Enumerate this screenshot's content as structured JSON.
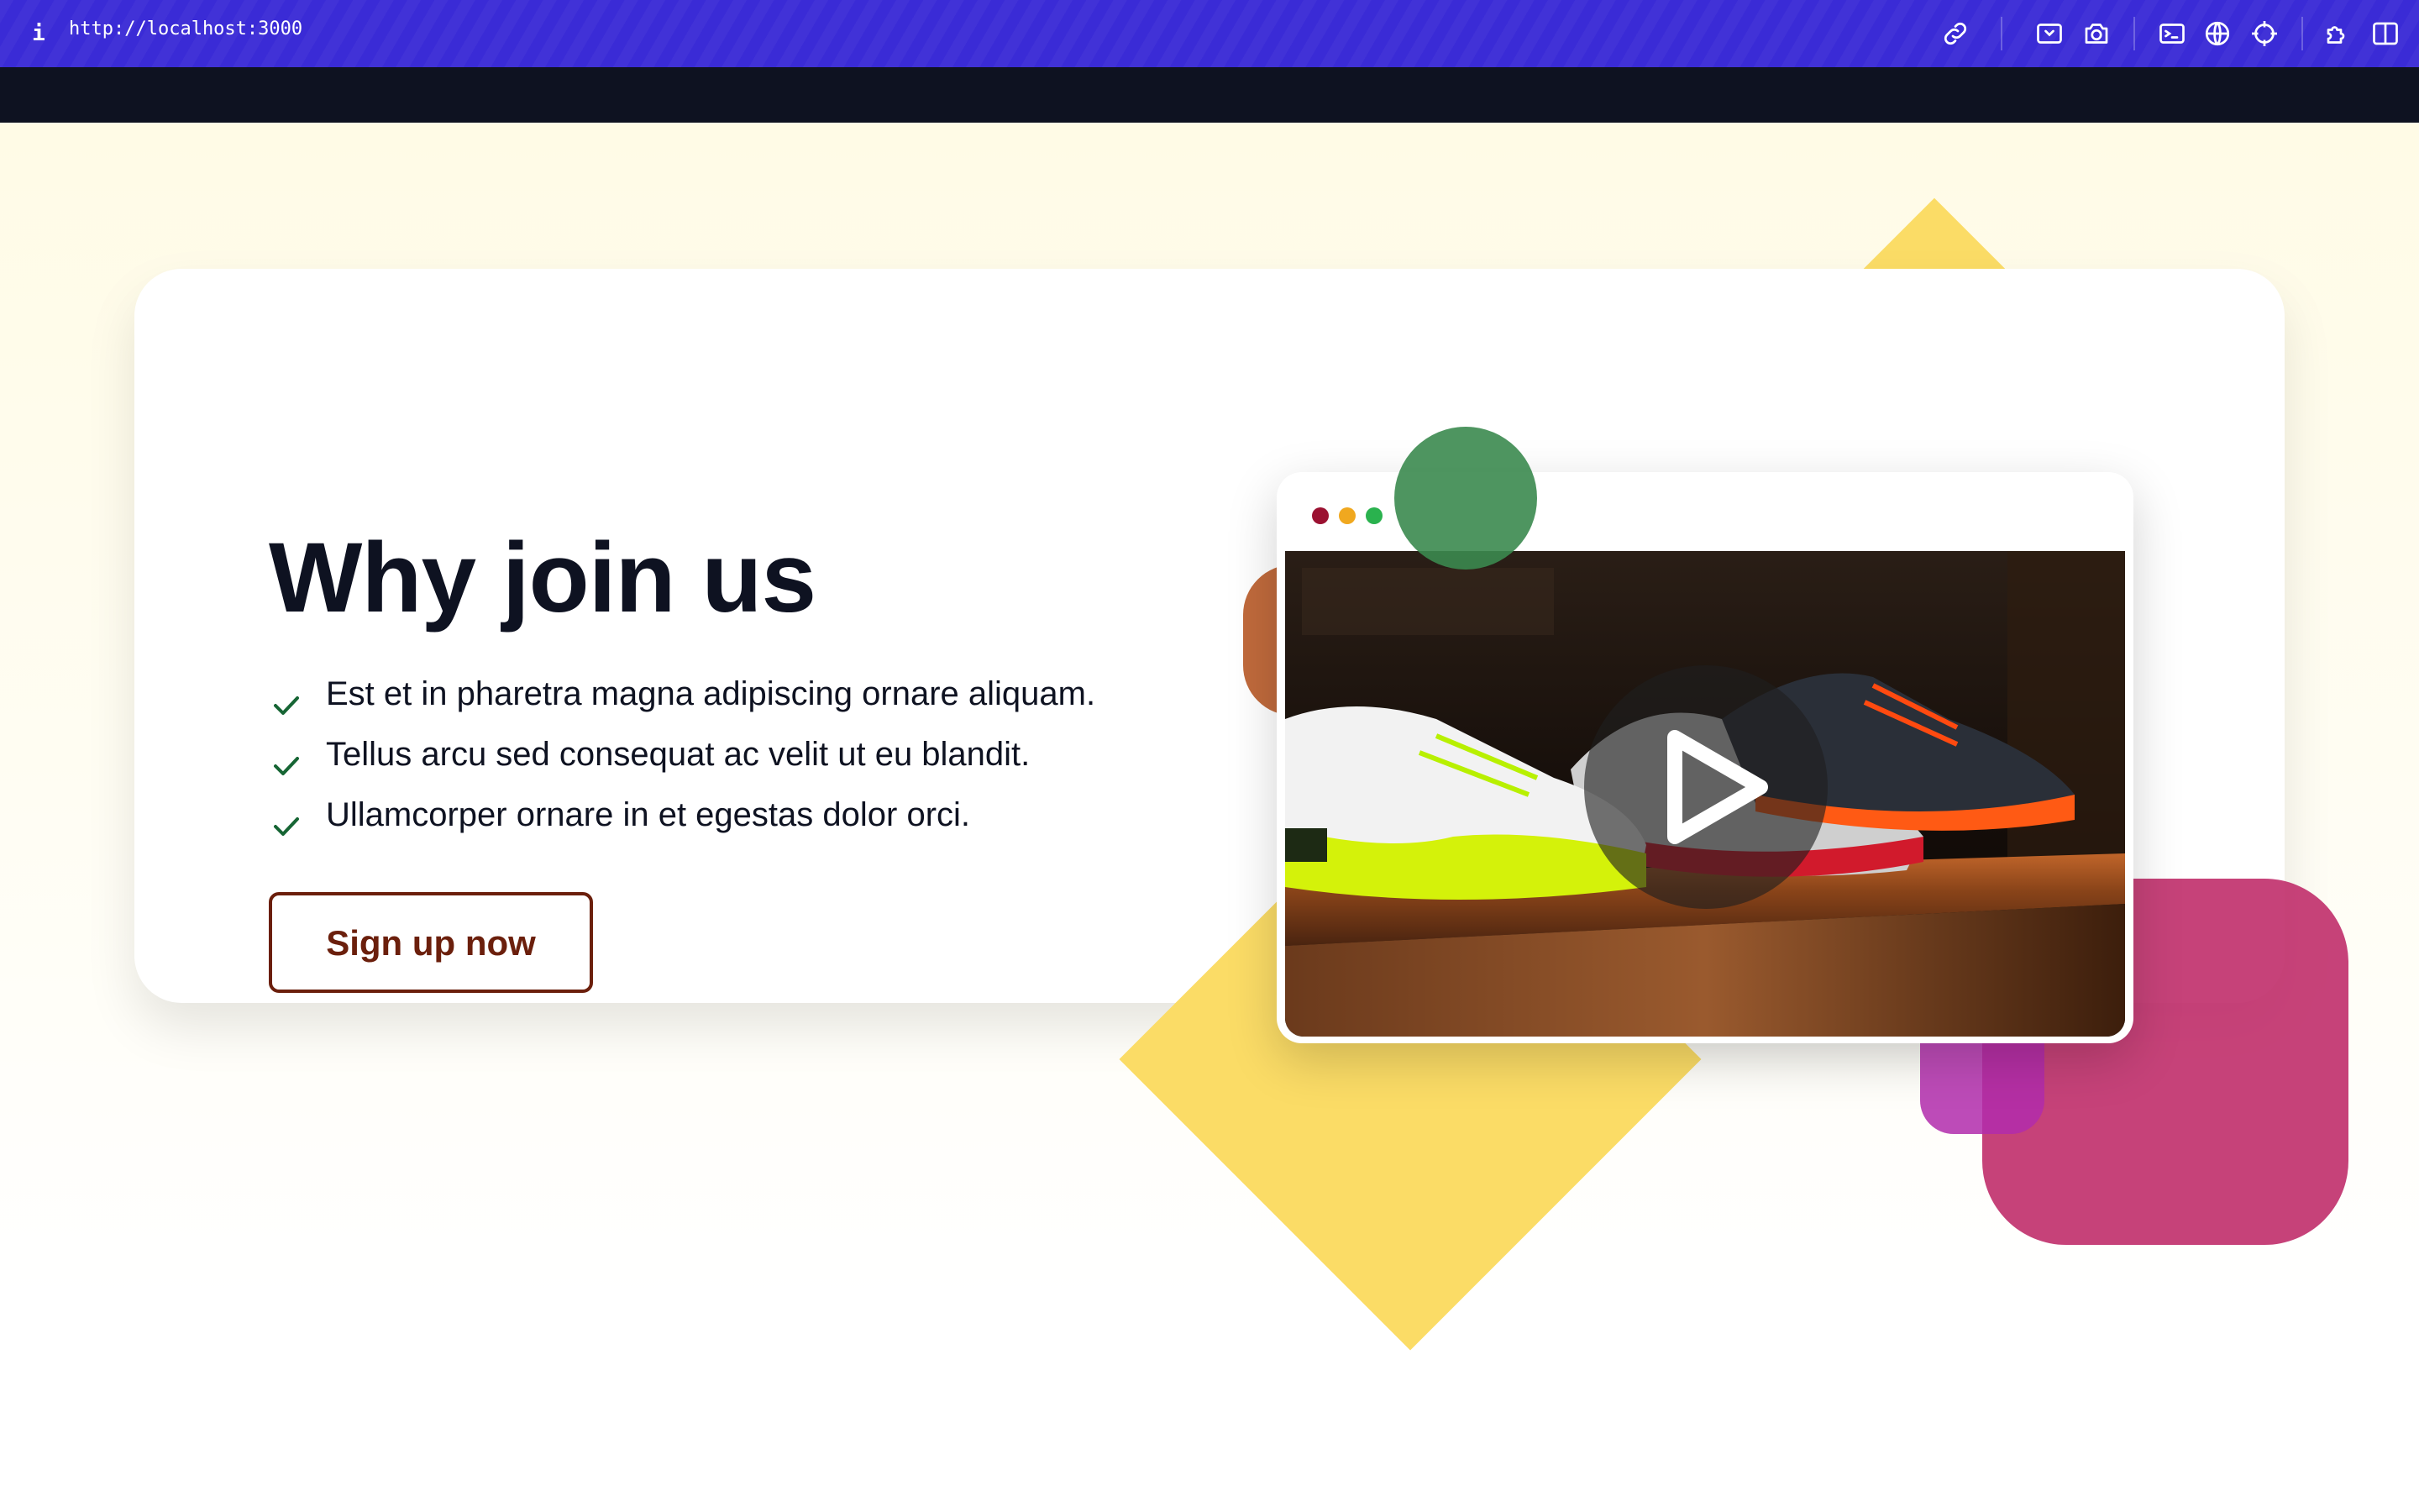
{
  "browser": {
    "info_glyph": "i",
    "url": "http://localhost:3000",
    "toolbar_icons": [
      "link-icon",
      "inspect-icon",
      "camera-icon",
      "terminal-icon",
      "globe-icon",
      "crosshair-icon",
      "extension-icon",
      "split-view-icon"
    ]
  },
  "hero": {
    "title": "Why join us",
    "features": [
      "Est et in pharetra magna adipiscing ornare aliquam.",
      "Tellus arcu sed consequat ac velit ut eu blandit.",
      "Ullamcorper ornare in et egestas dolor orci."
    ],
    "cta_label": "Sign up now"
  },
  "colors": {
    "toolbar": "#3a2bd6",
    "title": "#0e1221",
    "check": "#166534",
    "cta": "#6b1f0c",
    "diamond": "#fbdc66",
    "blue_circle": "#3f7aa8",
    "green_circle": "#3b8a4f",
    "pink_square": "#c02e6a"
  },
  "video": {
    "window_dots": [
      "red",
      "yellow",
      "green"
    ],
    "play_icon": "play-icon"
  }
}
